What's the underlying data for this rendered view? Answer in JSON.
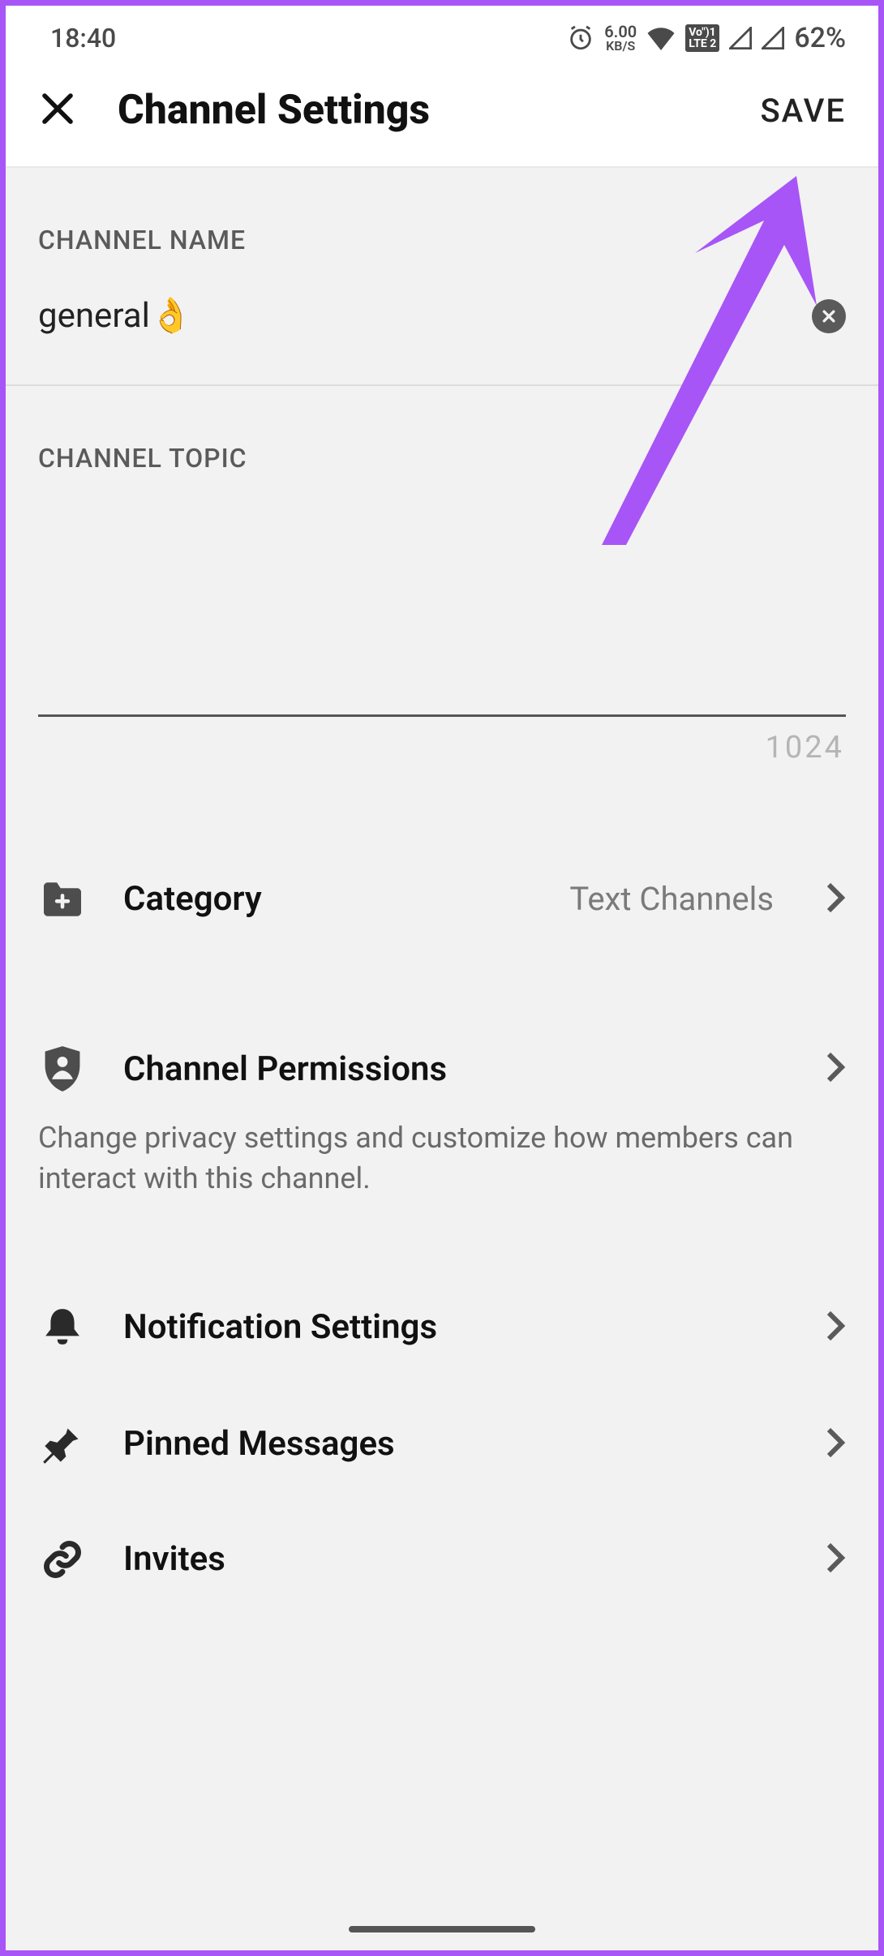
{
  "status": {
    "time": "18:40",
    "net_speed_top": "6.00",
    "net_speed_bottom": "KB/S",
    "lte1": "Vo\")1",
    "lte2": "LTE 2",
    "battery": "62%"
  },
  "appbar": {
    "title": "Channel Settings",
    "save": "SAVE"
  },
  "sections": {
    "name_label": "CHANNEL NAME",
    "name_value": "general👌",
    "topic_label": "CHANNEL TOPIC",
    "topic_value": "",
    "topic_char_limit": "1024"
  },
  "items": {
    "category": {
      "label": "Category",
      "value": "Text Channels"
    },
    "permissions": {
      "label": "Channel Permissions",
      "desc": "Change privacy settings and customize how members can interact with this channel."
    },
    "notifications": {
      "label": "Notification Settings"
    },
    "pinned": {
      "label": "Pinned Messages"
    },
    "invites": {
      "label": "Invites"
    }
  }
}
